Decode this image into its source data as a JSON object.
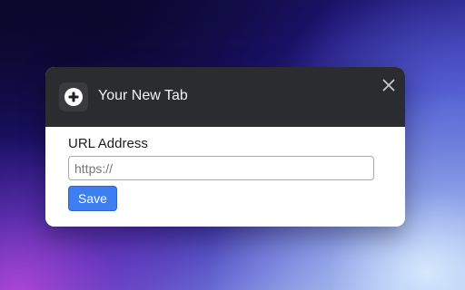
{
  "modal": {
    "title": "Your New Tab",
    "app_icon": "plus-circle-icon",
    "close_icon": "close-icon"
  },
  "form": {
    "url_label": "URL Address",
    "url_placeholder": "https://",
    "url_value": "",
    "save_label": "Save"
  },
  "colors": {
    "header_background": "#2b2c30",
    "accent": "#3d7ff0",
    "title_text": "#f2f2f2"
  }
}
